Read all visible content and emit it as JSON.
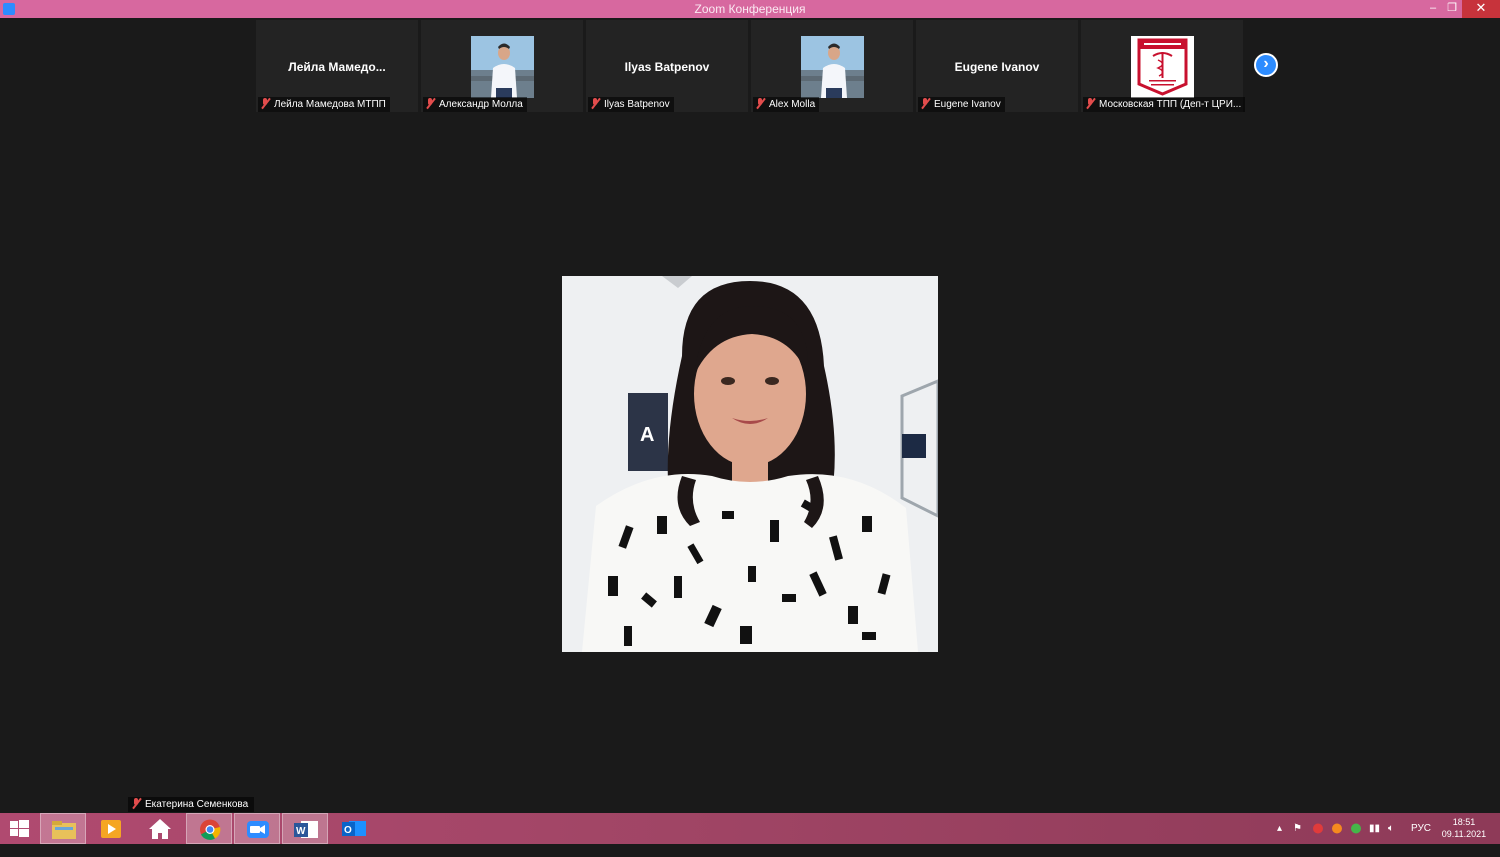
{
  "window": {
    "title": "Zoom Конференция",
    "controls": {
      "minimize": "–",
      "restore": "❐",
      "close": "✕"
    }
  },
  "participants": [
    {
      "tile_name": "Лейла  Мамедо...",
      "caption": "Лейла Мамедова МТПП",
      "has_video": false
    },
    {
      "tile_name": "",
      "caption": "Александр Молла",
      "has_video": true,
      "thumb": "person-photo"
    },
    {
      "tile_name": "Ilyas Batpenov",
      "caption": "Ilyas Batpenov",
      "has_video": false
    },
    {
      "tile_name": "",
      "caption": "Alex Molla",
      "has_video": true,
      "thumb": "person-photo"
    },
    {
      "tile_name": "Eugene Ivanov",
      "caption": "Eugene Ivanov",
      "has_video": false
    },
    {
      "tile_name": "",
      "caption": "Московская ТПП (Деп-т ЦРИ...",
      "has_video": true,
      "thumb": "chamber-logo"
    }
  ],
  "next_page_icon": "chevron-right-icon",
  "active_speaker": {
    "name": "Екатерина Семенкова"
  },
  "taskbar": {
    "apps": [
      "windows-start-icon",
      "file-explorer-icon",
      "media-player-icon",
      "home-icon",
      "chrome-icon",
      "zoom-icon",
      "word-icon",
      "outlook-icon"
    ],
    "active_app": "zoom-icon",
    "language": "РУС",
    "time": "18:51",
    "date": "09.11.2021"
  },
  "colors": {
    "titlebar": "#d7689f",
    "close_button": "#c7333b",
    "stage_bg": "#1a1a1a",
    "tile_bg": "#232323",
    "muted_mic": "#e24c4c",
    "zoom_blue": "#2d8cff"
  }
}
